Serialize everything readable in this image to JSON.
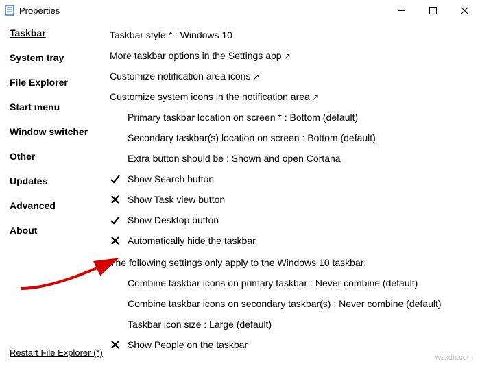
{
  "window": {
    "title": "Properties"
  },
  "sidebar": {
    "items": [
      {
        "label": "Taskbar",
        "selected": true
      },
      {
        "label": "System tray"
      },
      {
        "label": "File Explorer"
      },
      {
        "label": "Start menu"
      },
      {
        "label": "Window switcher"
      },
      {
        "label": "Other"
      },
      {
        "label": "Updates"
      },
      {
        "label": "Advanced"
      },
      {
        "label": "About"
      }
    ]
  },
  "main": {
    "items": [
      {
        "kind": "plain",
        "text": "Taskbar style * : Windows 10"
      },
      {
        "kind": "link",
        "text": "More taskbar options in the Settings app"
      },
      {
        "kind": "link",
        "text": "Customize notification area icons"
      },
      {
        "kind": "link",
        "text": "Customize system icons in the notification area"
      },
      {
        "kind": "plain",
        "indent": true,
        "text": "Primary taskbar location on screen * : Bottom (default)"
      },
      {
        "kind": "plain",
        "indent": true,
        "text": "Secondary taskbar(s) location on screen : Bottom (default)"
      },
      {
        "kind": "plain",
        "indent": true,
        "text": "Extra button should be : Shown and open Cortana"
      },
      {
        "kind": "check",
        "checked": true,
        "text": "Show Search button"
      },
      {
        "kind": "check",
        "checked": false,
        "text": "Show Task view button"
      },
      {
        "kind": "check",
        "checked": true,
        "text": "Show Desktop button"
      },
      {
        "kind": "check",
        "checked": false,
        "text": "Automatically hide the taskbar"
      },
      {
        "kind": "heading",
        "text": "The following settings only apply to the Windows 10 taskbar:"
      },
      {
        "kind": "plain",
        "indent": true,
        "text": "Combine taskbar icons on primary taskbar : Never combine (default)"
      },
      {
        "kind": "plain",
        "indent": true,
        "text": "Combine taskbar icons on secondary taskbar(s) : Never combine (default)"
      },
      {
        "kind": "plain",
        "indent": true,
        "text": "Taskbar icon size : Large (default)"
      },
      {
        "kind": "check",
        "checked": false,
        "text": "Show People on the taskbar"
      }
    ]
  },
  "footer": {
    "restart": "Restart File Explorer (*)"
  },
  "watermark": "wsxdn.com"
}
